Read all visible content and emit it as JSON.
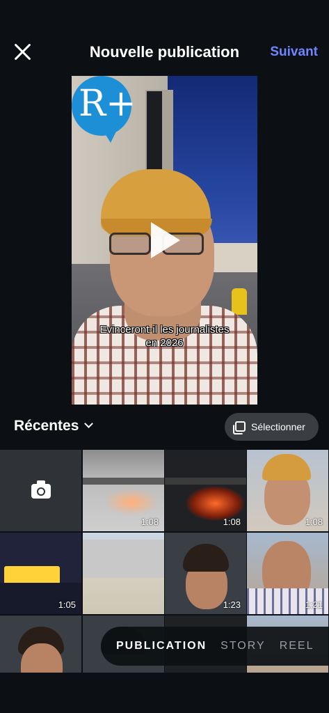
{
  "header": {
    "title": "Nouvelle publication",
    "next_label": "Suivant"
  },
  "preview": {
    "logo_text": "R+",
    "caption_line1": "Evinceront-il  les journalistes",
    "caption_line2": "en 2026"
  },
  "gallery": {
    "album_label": "Récentes",
    "select_label": "Sélectionner",
    "tiles": [
      {
        "kind": "camera",
        "duration": ""
      },
      {
        "kind": "video",
        "duration": "1:08"
      },
      {
        "kind": "video",
        "duration": "1:08"
      },
      {
        "kind": "video",
        "duration": "1:08"
      },
      {
        "kind": "video",
        "duration": "1:05"
      },
      {
        "kind": "photo",
        "duration": ""
      },
      {
        "kind": "video",
        "duration": "1:23"
      },
      {
        "kind": "video",
        "duration": "1:21"
      }
    ]
  },
  "modes": {
    "publication": "PUBLICATION",
    "story": "STORY",
    "reel": "REEL"
  },
  "colors": {
    "accent": "#6f86ff",
    "background": "#0c1014"
  }
}
